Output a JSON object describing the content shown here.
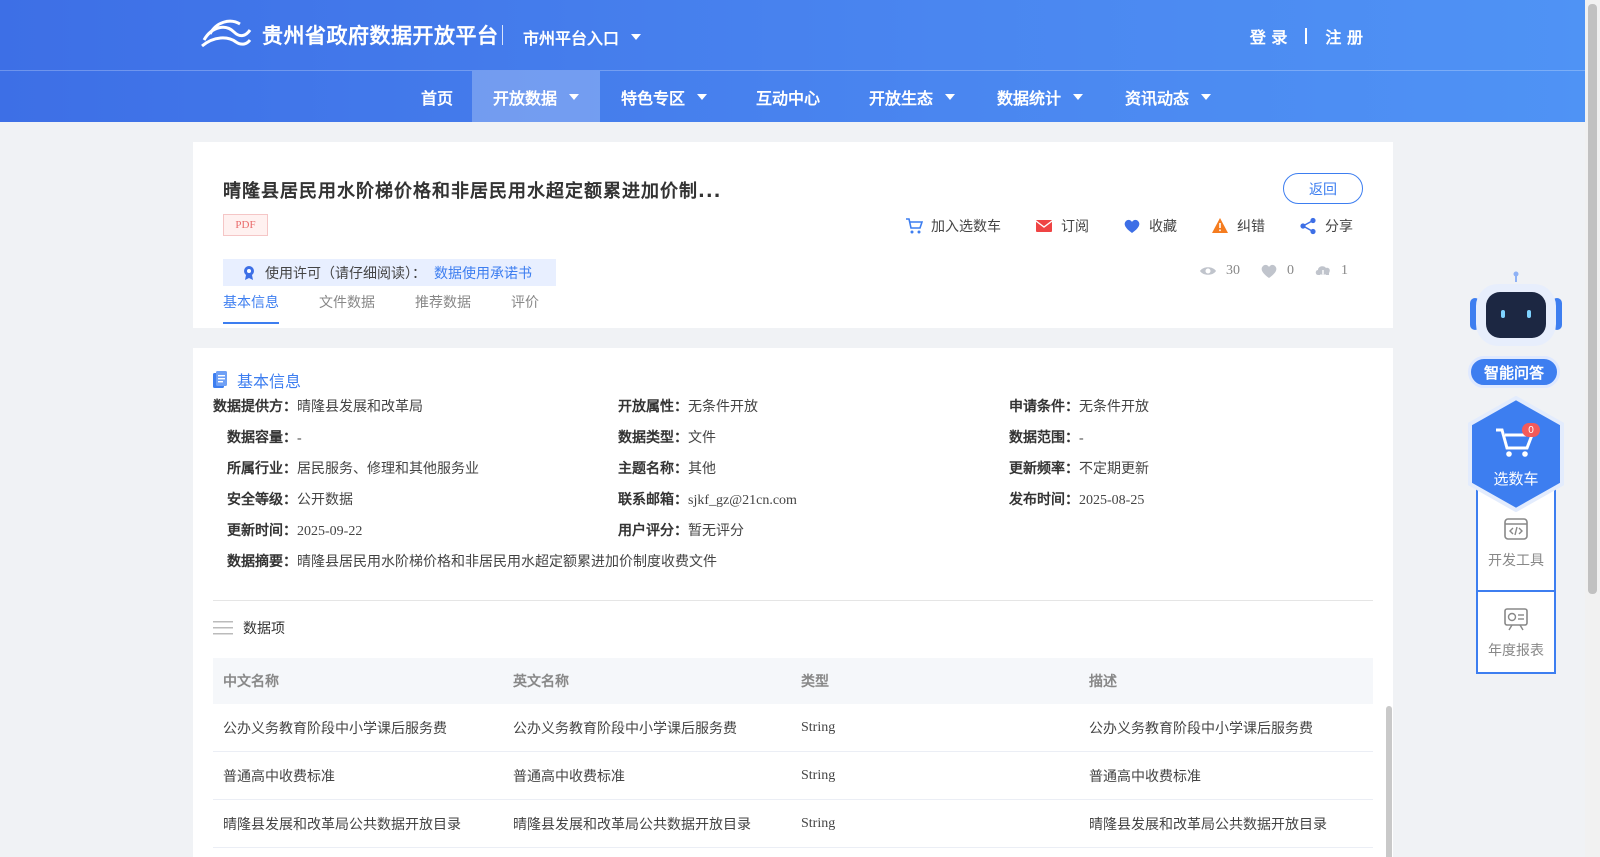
{
  "header": {
    "site_title": "贵州省政府数据开放平台",
    "city_entry": "市州平台入口",
    "login": "登 录",
    "register": "注 册"
  },
  "nav": [
    {
      "label": "首页",
      "dropdown": false,
      "active": false
    },
    {
      "label": "开放数据",
      "dropdown": true,
      "active": true
    },
    {
      "label": "特色专区",
      "dropdown": true,
      "active": false
    },
    {
      "label": "互动中心",
      "dropdown": false,
      "active": false
    },
    {
      "label": "开放生态",
      "dropdown": true,
      "active": false
    },
    {
      "label": "数据统计",
      "dropdown": true,
      "active": false
    },
    {
      "label": "资讯动态",
      "dropdown": true,
      "active": false
    }
  ],
  "dataset": {
    "title": "晴隆县居民用水阶梯价格和非居民用水超定额累进加价制...",
    "format_tag": "PDF",
    "back": "返回",
    "actions": {
      "cart": "加入选数车",
      "subscribe": "订阅",
      "favorite": "收藏",
      "report": "纠错",
      "share": "分享"
    },
    "license_label": "使用许可（请仔细阅读）：",
    "license_link": "数据使用承诺书",
    "stats": {
      "views": "30",
      "likes": "0",
      "downloads": "1"
    },
    "tabs": [
      "基本信息",
      "文件数据",
      "推荐数据",
      "评价"
    ]
  },
  "basic_info": {
    "section_title": "基本信息",
    "fields": {
      "provider": {
        "k": "数据提供方：",
        "v": "晴隆县发展和改革局"
      },
      "open_attr": {
        "k": "开放属性：",
        "v": "无条件开放"
      },
      "apply_cond": {
        "k": "申请条件：",
        "v": "无条件开放"
      },
      "capacity": {
        "k": "数据容量：",
        "v": "-"
      },
      "data_type": {
        "k": "数据类型：",
        "v": "文件"
      },
      "scope": {
        "k": "数据范围：",
        "v": "-"
      },
      "industry": {
        "k": "所属行业：",
        "v": "居民服务、修理和其他服务业"
      },
      "theme": {
        "k": "主题名称：",
        "v": "其他"
      },
      "frequency": {
        "k": "更新频率：",
        "v": "不定期更新"
      },
      "security": {
        "k": "安全等级：",
        "v": "公开数据"
      },
      "email": {
        "k": "联系邮箱：",
        "v": "sjkf_gz@21cn.com"
      },
      "publish_time": {
        "k": "发布时间：",
        "v": "2025-08-25"
      },
      "update_time": {
        "k": "更新时间：",
        "v": "2025-09-22"
      },
      "rating": {
        "k": "用户评分：",
        "v": "暂无评分"
      },
      "summary": {
        "k": "数据摘要：",
        "v": "晴隆县居民用水阶梯价格和非居民用水超定额累进加价制度收费文件"
      }
    }
  },
  "data_items": {
    "title": "数据项",
    "columns": [
      "中文名称",
      "英文名称",
      "类型",
      "描述"
    ],
    "rows": [
      [
        "公办义务教育阶段中小学课后服务费",
        "公办义务教育阶段中小学课后服务费",
        "String",
        "公办义务教育阶段中小学课后服务费"
      ],
      [
        "普通高中收费标准",
        "普通高中收费标准",
        "String",
        "普通高中收费标准"
      ],
      [
        "晴隆县发展和改革局公共数据开放目录",
        "晴隆县发展和改革局公共数据开放目录",
        "String",
        "晴隆县发展和改革局公共数据开放目录"
      ]
    ]
  },
  "side": {
    "qa": "智能问答",
    "cart": "选数车",
    "cart_count": "0",
    "dev_tools": "开发工具",
    "annual_report": "年度报表"
  },
  "colors": {
    "primary": "#3d7ef0",
    "header_start": "#3d6fe6",
    "header_end": "#4f93f5"
  }
}
